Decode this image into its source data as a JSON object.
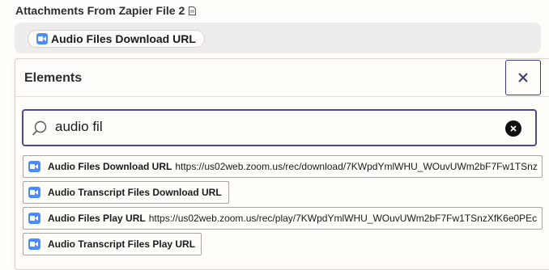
{
  "field": {
    "label": "Attachments From Zapier File 2",
    "label_icon": "document-icon",
    "selected_pill": {
      "icon": "zoom-icon",
      "label": "Audio Files Download URL"
    }
  },
  "elements_panel": {
    "title": "Elements",
    "close_icon": "close-icon",
    "search": {
      "value": "audio fil",
      "icon": "search-icon",
      "clear_icon": "clear-icon"
    },
    "options": [
      {
        "icon": "zoom-icon",
        "label": "Audio Files Download URL",
        "value": "https://us02web.zoom.us/rec/download/7KWpdYmlWHU_WOuvUWm2bF7Fw1TSnz"
      },
      {
        "icon": "zoom-icon",
        "label": "Audio Transcript Files Download URL",
        "value": ""
      },
      {
        "icon": "zoom-icon",
        "label": "Audio Files Play URL",
        "value": "https://us02web.zoom.us/rec/play/7KWpdYmlWHU_WOuvUWm2bF7Fw1TSnzXfK6e0PEc"
      },
      {
        "icon": "zoom-icon",
        "label": "Audio Transcript Files Play URL",
        "value": ""
      }
    ]
  },
  "colors": {
    "background": "#fffdf9",
    "accent": "#4b4b8f",
    "zoom_blue": "#4a8cff"
  }
}
